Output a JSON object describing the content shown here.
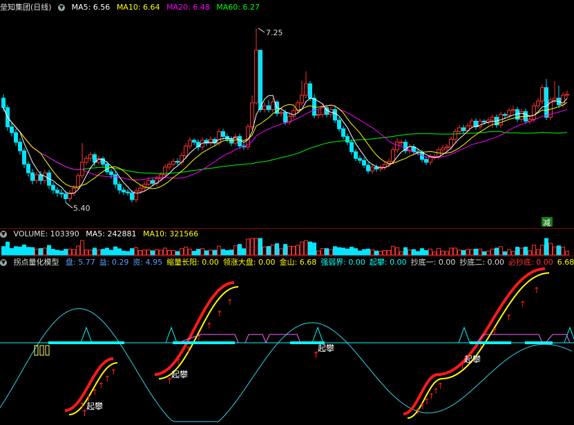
{
  "header": {
    "title": "垒知集团(日线)",
    "ma5_label": "MA5: 6.56",
    "ma10_label": "MA10: 6.64",
    "ma20_label": "MA20: 6.48",
    "ma60_label": "MA60: 6.27"
  },
  "volume_header": {
    "title": "VOLUME: 103390",
    "ma5_label": "MA5: 242881",
    "ma10_label": "MA10: 321566"
  },
  "indicator_header": {
    "title": "拐点量化模型",
    "items": [
      {
        "text": "盘: 5.77",
        "color": "#5aa0ff"
      },
      {
        "text": "益: 0.29",
        "color": "#5aa0ff"
      },
      {
        "text": "资: 4.95",
        "color": "#5aa0ff"
      },
      {
        "text": "缩量长阳: 0.00",
        "color": "#ffff00"
      },
      {
        "text": "领涨大盘: 0.00",
        "color": "#ffff00"
      },
      {
        "text": "金山: 6.68",
        "color": "#ffff00"
      },
      {
        "text": "强弱界: 0.00",
        "color": "#00ffff"
      },
      {
        "text": "起攀: 0.00",
        "color": "#00ffff"
      },
      {
        "text": "抄底一: 0.00",
        "color": "#dddddd"
      },
      {
        "text": "抄底二: 0.00",
        "color": "#dddddd"
      },
      {
        "text": "必抄底: 0.00",
        "color": "#ff3030"
      },
      {
        "text": "6.68",
        "color": "#ffff00"
      }
    ]
  },
  "annotations": {
    "high": "7.25",
    "low": "5.40",
    "signal_label": "起攀",
    "reduce_label": "减"
  },
  "colors": {
    "up": "#ff3232",
    "down": "#00e5ff",
    "ma5": "#ffffff",
    "ma10": "#ffff00",
    "ma20": "#ff00ff",
    "ma60": "#00ff00",
    "osc": "#33d6e8",
    "trend_red": "#ff1a1a",
    "trend_yellow": "#ffff00",
    "baseline": "#00ffff",
    "box": "#ff66ff"
  },
  "chart_data": {
    "type": "candlestick",
    "ylim": [
      5.25,
      7.4
    ],
    "x": [
      1,
      2,
      3,
      4,
      5,
      6,
      7,
      8,
      9,
      10,
      11,
      12,
      13,
      14,
      15,
      16,
      17,
      18,
      19,
      20,
      21,
      22,
      23,
      24,
      25,
      26,
      27,
      28,
      29,
      30,
      31,
      32,
      33,
      34,
      35,
      36,
      37,
      38,
      39,
      40,
      41,
      42,
      43,
      44,
      45,
      46,
      47,
      48,
      49,
      50,
      51,
      52,
      53,
      54,
      55,
      56,
      57,
      58,
      59,
      60,
      61,
      62,
      63,
      64,
      65,
      66,
      67,
      68,
      69,
      70,
      71,
      72,
      73,
      74,
      75,
      76,
      77,
      78,
      79,
      80,
      81,
      82,
      83,
      84,
      85,
      86,
      87,
      88,
      89,
      90,
      91,
      92,
      93,
      94,
      95,
      96,
      97,
      98,
      99,
      100,
      101,
      102,
      103,
      104,
      105,
      106,
      107,
      108,
      109,
      110,
      111,
      112,
      113,
      114,
      115,
      116,
      117,
      118,
      119,
      120,
      121,
      122,
      123,
      124,
      125,
      126,
      127,
      128,
      129,
      130,
      131,
      132,
      133,
      134,
      135,
      136,
      137
    ],
    "open": [
      6.52,
      6.42,
      6.22,
      6.16,
      6.06,
      5.97,
      5.83,
      5.74,
      5.66,
      5.72,
      5.66,
      5.74,
      5.61,
      5.56,
      5.53,
      5.52,
      5.47,
      5.53,
      5.58,
      5.71,
      5.85,
      5.89,
      5.93,
      5.85,
      5.89,
      5.83,
      5.75,
      5.72,
      5.62,
      5.56,
      5.54,
      5.53,
      5.46,
      5.55,
      5.58,
      5.62,
      5.66,
      5.63,
      5.68,
      5.72,
      5.8,
      5.83,
      5.86,
      5.85,
      5.92,
      6.02,
      6.08,
      6.06,
      6.01,
      6.08,
      6.05,
      6.09,
      6.05,
      6.17,
      6.12,
      6.09,
      6.05,
      6.12,
      6.02,
      6.01,
      6.22,
      6.47,
      7.02,
      6.4,
      6.44,
      6.4,
      6.48,
      6.36,
      6.37,
      6.27,
      6.33,
      6.39,
      6.47,
      6.55,
      6.67,
      6.52,
      6.34,
      6.35,
      6.42,
      6.35,
      6.4,
      6.29,
      6.2,
      6.12,
      6.06,
      5.96,
      5.89,
      5.87,
      5.82,
      5.76,
      5.8,
      5.78,
      5.8,
      5.83,
      5.86,
      5.98,
      6.06,
      6.06,
      5.97,
      6.01,
      5.96,
      5.95,
      5.88,
      5.85,
      5.91,
      5.91,
      5.98,
      6.0,
      6.01,
      6.09,
      6.17,
      6.21,
      6.18,
      6.23,
      6.28,
      6.22,
      6.28,
      6.27,
      6.29,
      6.32,
      6.24,
      6.35,
      6.34,
      6.39,
      6.4,
      6.3,
      6.38,
      6.28,
      6.3,
      6.44,
      6.49,
      6.63,
      6.32,
      6.5,
      6.52,
      6.45,
      6.55
    ],
    "close": [
      6.42,
      6.22,
      6.16,
      6.06,
      5.97,
      5.83,
      5.74,
      5.66,
      5.72,
      5.66,
      5.74,
      5.61,
      5.56,
      5.53,
      5.52,
      5.47,
      5.53,
      5.58,
      5.71,
      5.85,
      5.89,
      5.93,
      5.85,
      5.89,
      5.83,
      5.75,
      5.72,
      5.62,
      5.56,
      5.54,
      5.53,
      5.46,
      5.55,
      5.58,
      5.62,
      5.66,
      5.63,
      5.68,
      5.72,
      5.8,
      5.83,
      5.86,
      5.85,
      5.92,
      6.02,
      6.08,
      6.06,
      6.01,
      6.08,
      6.05,
      6.09,
      6.05,
      6.17,
      6.12,
      6.09,
      6.05,
      6.12,
      6.02,
      6.01,
      6.22,
      6.47,
      7.02,
      6.4,
      6.44,
      6.4,
      6.48,
      6.36,
      6.37,
      6.27,
      6.33,
      6.39,
      6.47,
      6.55,
      6.67,
      6.52,
      6.34,
      6.35,
      6.42,
      6.35,
      6.4,
      6.29,
      6.2,
      6.12,
      6.06,
      5.96,
      5.89,
      5.87,
      5.82,
      5.76,
      5.8,
      5.78,
      5.8,
      5.83,
      5.86,
      5.98,
      6.06,
      6.06,
      5.97,
      6.01,
      5.96,
      5.95,
      5.88,
      5.85,
      5.91,
      5.91,
      5.98,
      6.0,
      6.01,
      6.09,
      6.17,
      6.21,
      6.18,
      6.23,
      6.28,
      6.22,
      6.28,
      6.27,
      6.29,
      6.32,
      6.24,
      6.35,
      6.34,
      6.39,
      6.4,
      6.3,
      6.38,
      6.28,
      6.3,
      6.44,
      6.49,
      6.63,
      6.32,
      6.5,
      6.52,
      6.45,
      6.55,
      6.56
    ],
    "high": [
      6.56,
      6.45,
      6.26,
      6.2,
      6.1,
      6.0,
      5.86,
      5.78,
      5.75,
      5.76,
      5.77,
      5.77,
      5.64,
      5.59,
      5.57,
      5.55,
      5.56,
      5.61,
      5.74,
      6.05,
      5.92,
      5.96,
      5.95,
      5.92,
      5.91,
      5.86,
      5.78,
      5.75,
      5.65,
      5.59,
      5.57,
      5.56,
      5.58,
      5.61,
      5.65,
      5.69,
      5.68,
      5.71,
      5.75,
      5.83,
      5.86,
      5.89,
      5.89,
      5.95,
      6.05,
      6.11,
      6.1,
      6.09,
      6.11,
      6.1,
      6.12,
      6.11,
      6.2,
      6.2,
      6.15,
      6.12,
      6.15,
      6.15,
      6.05,
      6.25,
      6.55,
      7.25,
      6.85,
      6.48,
      6.5,
      6.52,
      6.5,
      6.4,
      6.4,
      6.36,
      6.42,
      6.5,
      6.7,
      6.8,
      6.7,
      6.56,
      6.4,
      6.45,
      6.45,
      6.43,
      6.43,
      6.32,
      6.23,
      6.15,
      6.09,
      5.99,
      5.92,
      5.9,
      5.85,
      5.83,
      5.83,
      5.82,
      5.86,
      5.89,
      6.01,
      6.1,
      6.09,
      6.09,
      6.04,
      6.04,
      5.99,
      5.98,
      5.91,
      5.94,
      5.94,
      6.01,
      6.03,
      6.04,
      6.12,
      6.2,
      6.24,
      6.24,
      6.26,
      6.31,
      6.31,
      6.31,
      6.3,
      6.32,
      6.35,
      6.35,
      6.38,
      6.37,
      6.42,
      6.44,
      6.43,
      6.41,
      6.41,
      6.34,
      6.47,
      6.52,
      6.66,
      6.72,
      6.53,
      6.7,
      6.65,
      6.58,
      6.6
    ],
    "low": [
      6.38,
      6.18,
      6.12,
      6.02,
      5.93,
      5.79,
      5.7,
      5.62,
      5.63,
      5.62,
      5.63,
      5.57,
      5.52,
      5.49,
      5.48,
      5.43,
      5.44,
      5.5,
      5.56,
      5.68,
      5.82,
      5.86,
      5.81,
      5.82,
      5.8,
      5.72,
      5.68,
      5.58,
      5.52,
      5.51,
      5.5,
      5.43,
      5.43,
      5.52,
      5.55,
      5.59,
      5.6,
      5.6,
      5.65,
      5.69,
      5.77,
      5.8,
      5.82,
      5.82,
      5.89,
      5.99,
      6.03,
      5.97,
      5.98,
      6.02,
      6.02,
      6.02,
      6.02,
      6.09,
      6.06,
      6.02,
      6.02,
      5.99,
      5.98,
      5.98,
      6.19,
      6.45,
      6.37,
      6.37,
      6.37,
      6.37,
      6.33,
      6.33,
      6.24,
      6.24,
      6.3,
      6.36,
      6.44,
      6.52,
      6.49,
      6.31,
      6.31,
      6.32,
      6.32,
      6.32,
      6.26,
      6.17,
      6.09,
      6.03,
      5.93,
      5.86,
      5.84,
      5.79,
      5.73,
      5.73,
      5.75,
      5.75,
      5.77,
      5.8,
      5.83,
      5.95,
      6.02,
      5.94,
      5.94,
      5.93,
      5.92,
      5.85,
      5.82,
      5.82,
      5.88,
      5.88,
      5.95,
      5.97,
      5.98,
      6.06,
      6.14,
      6.15,
      6.15,
      6.2,
      6.19,
      6.19,
      6.24,
      6.24,
      6.21,
      6.21,
      6.21,
      6.31,
      6.31,
      6.36,
      6.27,
      6.27,
      6.25,
      6.25,
      6.27,
      6.41,
      6.46,
      6.29,
      6.29,
      6.47,
      6.42,
      6.42,
      6.52
    ],
    "ma5_last": 6.56,
    "ma10_last": 6.64,
    "ma20_last": 6.48,
    "ma60_last": 6.27,
    "volume_last": 103390,
    "volume_ma5": 242881,
    "volume_ma10": 321566
  }
}
